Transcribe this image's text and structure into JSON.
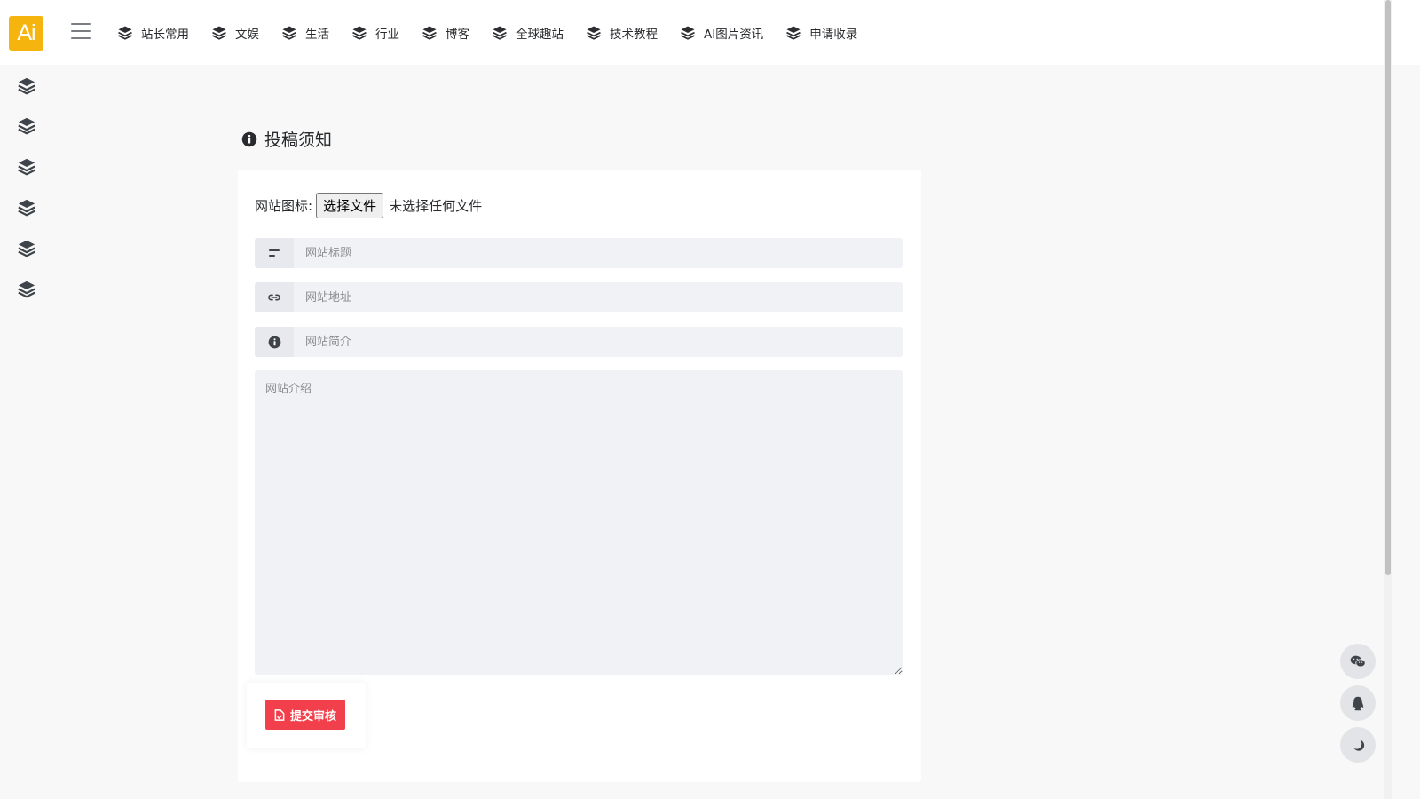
{
  "header": {
    "logo_text": "Ai",
    "nav": [
      {
        "label": "站长常用",
        "icon": "layers-icon"
      },
      {
        "label": "文娱",
        "icon": "layers-icon"
      },
      {
        "label": "生活",
        "icon": "layers-icon"
      },
      {
        "label": "行业",
        "icon": "layers-icon"
      },
      {
        "label": "博客",
        "icon": "layers-icon"
      },
      {
        "label": "全球趣站",
        "icon": "layers-icon"
      },
      {
        "label": "技术教程",
        "icon": "layers-icon"
      },
      {
        "label": "AI图片资讯",
        "icon": "layers-icon"
      },
      {
        "label": "申请收录",
        "icon": "layers-icon"
      }
    ]
  },
  "sidebar": {
    "icon": "layers-icon",
    "count": 6
  },
  "main": {
    "title": "投稿须知",
    "title_icon": "info-circle-icon",
    "form": {
      "file_label": "网站图标:",
      "file_button": "选择文件",
      "file_status": "未选择任何文件",
      "title_placeholder": "网站标题",
      "url_placeholder": "网站地址",
      "desc_placeholder": "网站简介",
      "intro_placeholder": "网站介绍",
      "submit_label": "提交审核"
    }
  },
  "float_buttons": [
    {
      "name": "wechat-icon"
    },
    {
      "name": "qq-icon"
    },
    {
      "name": "moon-icon"
    }
  ],
  "colors": {
    "accent": "#f1404b",
    "logo_bg": "#f6b40e",
    "background": "#f8f8f8",
    "text": "#282a2d"
  }
}
